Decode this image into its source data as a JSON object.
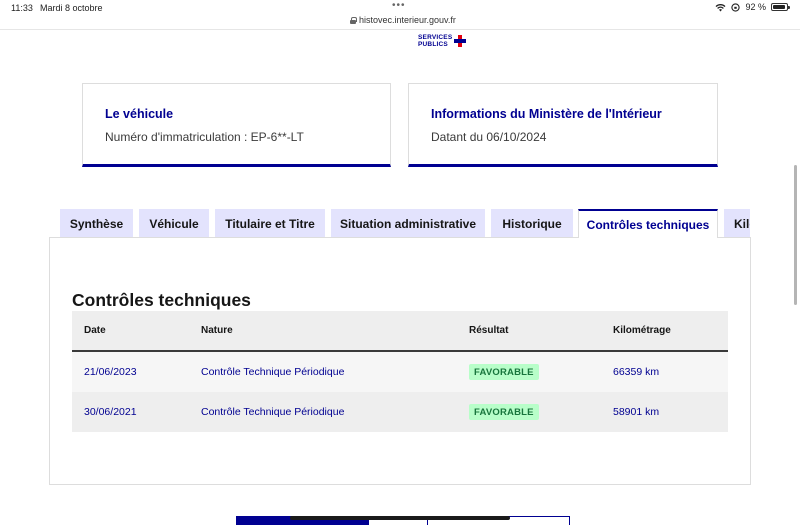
{
  "statusbar": {
    "time": "11:33",
    "date": "Mardi 8 octobre",
    "url": "histovec.interieur.gouv.fr",
    "battery": "92 %",
    "battery_level": 0.92
  },
  "logo": {
    "line1": "SERVICES",
    "line2": "PUBLICS"
  },
  "cards": {
    "vehicle": {
      "title": "Le véhicule",
      "text": "Numéro d'immatriculation : EP-6**-LT"
    },
    "ministry": {
      "title": "Informations du Ministère de l'Intérieur",
      "text": "Datant du 06/10/2024"
    }
  },
  "tabs": [
    {
      "label": "Synthèse"
    },
    {
      "label": "Véhicule"
    },
    {
      "label": "Titulaire et Titre"
    },
    {
      "label": "Situation administrative"
    },
    {
      "label": "Historique"
    },
    {
      "label": "Contrôles techniques",
      "active": true
    },
    {
      "label": "Kilo"
    }
  ],
  "section": {
    "title": "Contrôles techniques"
  },
  "table": {
    "headers": {
      "date": "Date",
      "nature": "Nature",
      "result": "Résultat",
      "km": "Kilométrage"
    },
    "rows": [
      {
        "date": "21/06/2023",
        "nature": "Contrôle Technique Périodique",
        "result": "FAVORABLE",
        "km": "66359 km"
      },
      {
        "date": "30/06/2021",
        "nature": "Contrôle Technique Périodique",
        "result": "FAVORABLE",
        "km": "58901 km"
      }
    ]
  },
  "colors": {
    "brand_blue": "#000091",
    "tab_bg": "#e3e3fd",
    "badge_bg": "#b8fec9",
    "badge_text": "#18753c",
    "marianne_red": "#e1000f"
  }
}
